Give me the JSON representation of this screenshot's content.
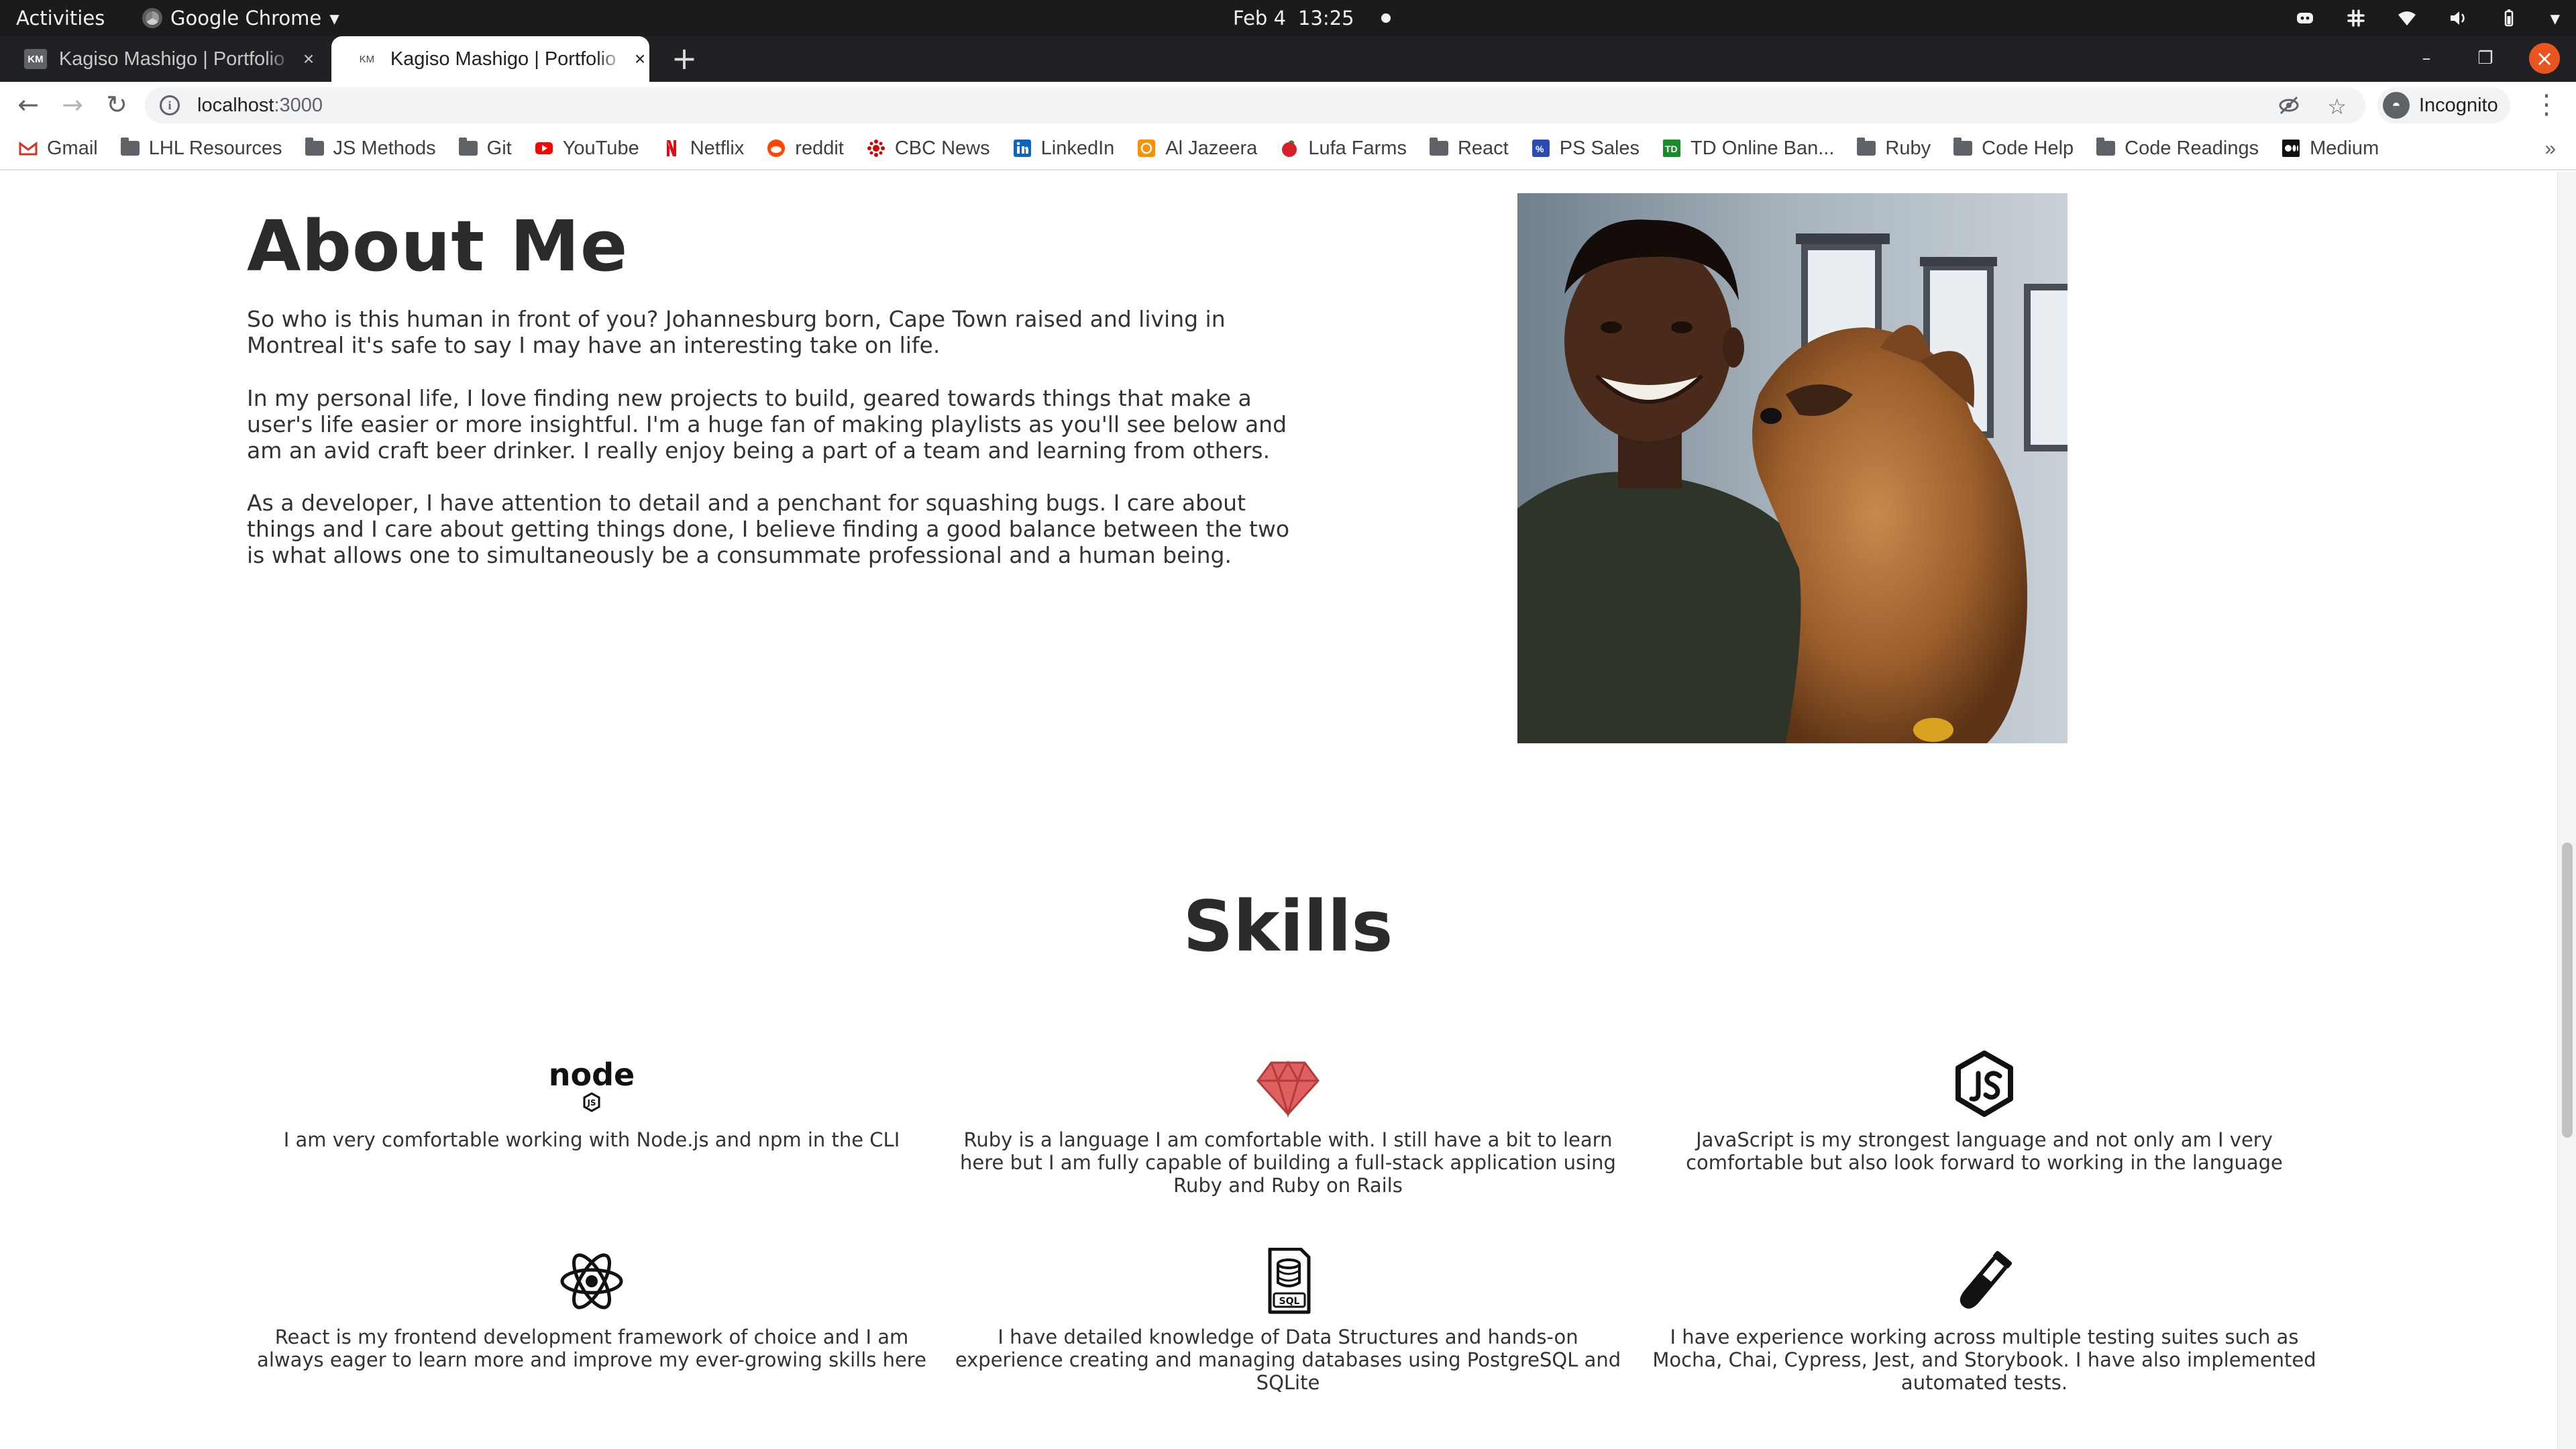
{
  "system_bar": {
    "activities": "Activities",
    "app_name": "Google Chrome",
    "date": "Feb 4",
    "time": "13:25"
  },
  "tabs": [
    {
      "favicon": "KM",
      "title": "Kagiso Mashigo | Portfolio"
    },
    {
      "favicon": "KM",
      "title": "Kagiso Mashigo | Portfolio"
    }
  ],
  "toolbar": {
    "url_host": "localhost",
    "url_port": ":3000",
    "profile_label": "Incognito"
  },
  "bookmarks": [
    {
      "label": "Gmail",
      "icon": "gmail-icon"
    },
    {
      "label": "LHL Resources",
      "icon": "folder-icon"
    },
    {
      "label": "JS Methods",
      "icon": "folder-icon"
    },
    {
      "label": "Git",
      "icon": "folder-icon"
    },
    {
      "label": "YouTube",
      "icon": "youtube-icon"
    },
    {
      "label": "Netflix",
      "icon": "netflix-icon"
    },
    {
      "label": "reddit",
      "icon": "reddit-icon"
    },
    {
      "label": "CBC News",
      "icon": "cbc-icon"
    },
    {
      "label": "LinkedIn",
      "icon": "linkedin-icon"
    },
    {
      "label": "Al Jazeera",
      "icon": "aljazeera-icon"
    },
    {
      "label": "Lufa Farms",
      "icon": "lufa-icon"
    },
    {
      "label": "React",
      "icon": "folder-icon"
    },
    {
      "label": "PS Sales",
      "icon": "ps-icon"
    },
    {
      "label": "TD Online Ban...",
      "icon": "td-icon"
    },
    {
      "label": "Ruby",
      "icon": "folder-icon"
    },
    {
      "label": "Code Help",
      "icon": "folder-icon"
    },
    {
      "label": "Code Readings",
      "icon": "folder-icon"
    },
    {
      "label": "Medium",
      "icon": "medium-icon"
    }
  ],
  "bookmarks_more": "»",
  "about": {
    "title": "About Me",
    "paragraphs": [
      "So who is this human in front of you? Johannesburg born, Cape Town raised and living in Montreal it's safe to say I may have an interesting take on life.",
      "In my personal life, I love finding new projects to build, geared towards things that make a user's life easier or more insightful. I'm a huge fan of making playlists as you'll see below and am an avid craft beer drinker. I really enjoy being a part of a team and learning from others.",
      "As a developer, I have attention to detail and a penchant for squashing bugs. I care about things and I care about getting things done, I believe finding a good balance between the two is what allows one to simultaneously be a consummate professional and a human being."
    ]
  },
  "skills": {
    "title": "Skills",
    "items": [
      {
        "icon": "nodejs-icon",
        "text": "I am very comfortable working with Node.js and npm in the CLI"
      },
      {
        "icon": "ruby-icon",
        "text": "Ruby is a language I am comfortable with. I still have a bit to learn here but I am fully capable of building a full-stack application using Ruby and Ruby on Rails"
      },
      {
        "icon": "javascript-icon",
        "text": "JavaScript is my strongest language and not only am I very comfortable but also look forward to working in the language"
      },
      {
        "icon": "react-icon",
        "text": "React is my frontend development framework of choice and I am always eager to learn more and improve my ever-growing skills here"
      },
      {
        "icon": "sql-icon",
        "text": "I have detailed knowledge of Data Structures and hands-on experience creating and managing databases using PostgreSQL and SQLite"
      },
      {
        "icon": "test-tube-icon",
        "text": "I have experience working across multiple testing suites such as Mocha, Chai, Cypress, Jest, and Storybook. I have also implemented automated tests."
      }
    ],
    "node_logo_text": "node",
    "node_badge": "JS",
    "sql_badge": "SQL"
  },
  "colors": {
    "ruby": "#e06060",
    "text": "#333333",
    "topbar": "#1b1b1b",
    "tabstrip": "#202124",
    "close_button": "#e95420"
  }
}
